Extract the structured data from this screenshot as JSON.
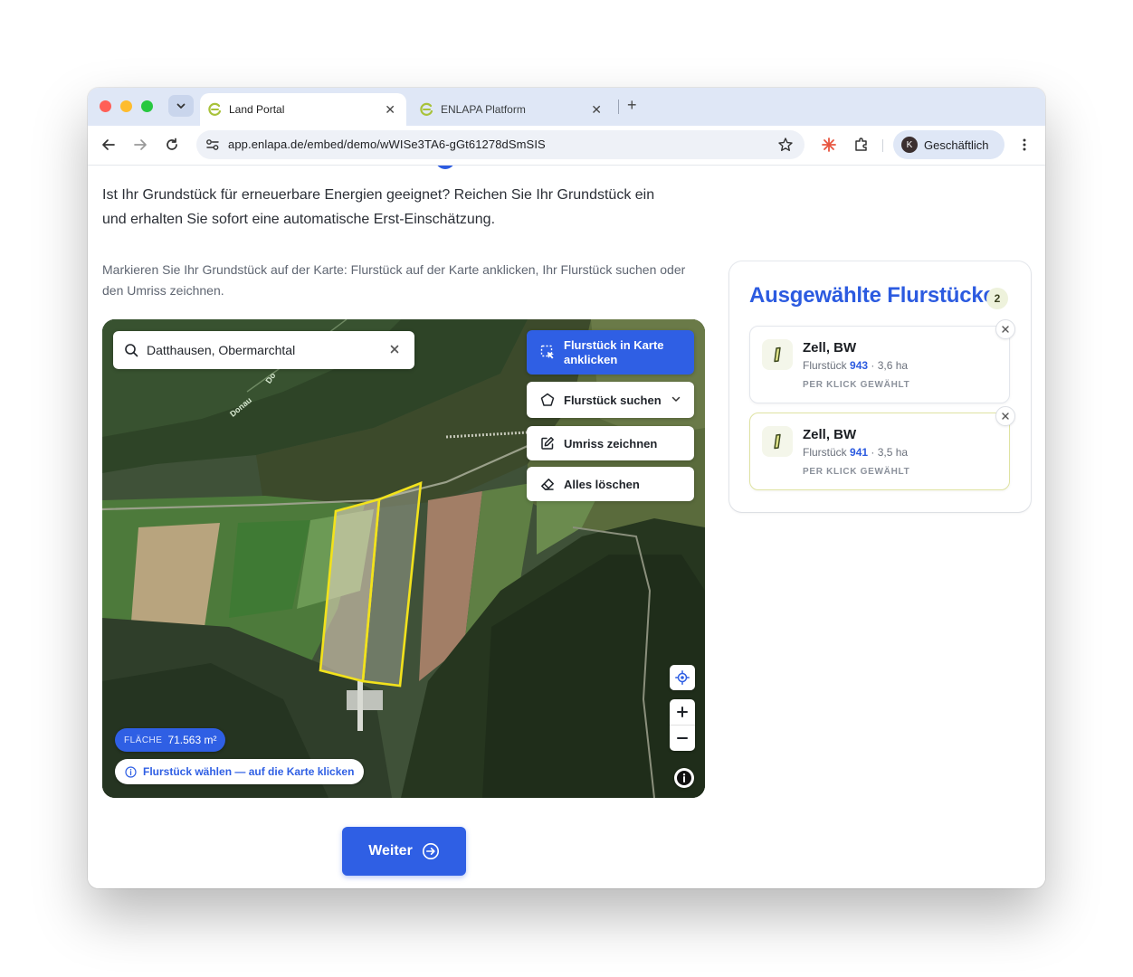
{
  "browser": {
    "tabs": [
      {
        "title": "Land Portal",
        "active": true
      },
      {
        "title": "ENLAPA Platform",
        "active": false
      }
    ],
    "url": "app.enlapa.de/embed/demo/wWISe3TA6-gGt61278dSmSIS",
    "profile_label": "Geschäftlich",
    "profile_initial": "K"
  },
  "page": {
    "intro": "Ist Ihr Grundstück für erneuerbare Energien geeignet? Reichen Sie Ihr Grundstück ein und erhalten Sie sofort eine automatische Erst-Einschätzung.",
    "instructions": "Markieren Sie Ihr Grundstück auf der Karte: Flurstück auf der Karte anklicken, Ihr Flurstück suchen oder den Umriss zeichnen.",
    "next_label": "Weiter"
  },
  "map": {
    "search_value": "Datthausen, Obermarchtal",
    "controls": {
      "click_mode": "Flurstück in Karte anklicken",
      "search": "Flurstück suchen",
      "draw": "Umriss zeichnen",
      "clear": "Alles löschen"
    },
    "area_label": "FLÄCHE",
    "area_value": "71.563 m²",
    "hint": "Flurstück wählen — auf die Karte klicken",
    "road_labels": [
      "Donau",
      "Do"
    ]
  },
  "selection": {
    "title": "Ausgewählte Flurstücke",
    "count": "2",
    "items": [
      {
        "place": "Zell, BW",
        "prefix": "Flurstück",
        "number": "943",
        "area": "· 3,6 ha",
        "method": "PER KLICK GEWÄHLT"
      },
      {
        "place": "Zell, BW",
        "prefix": "Flurstück",
        "number": "941",
        "area": "· 3,5 ha",
        "method": "PER KLICK GEWÄHLT"
      }
    ]
  },
  "colors": {
    "accent": "#2f5fe4",
    "parcel_outline": "#f2e21c",
    "selected_card_border": "#dfe3a2"
  }
}
